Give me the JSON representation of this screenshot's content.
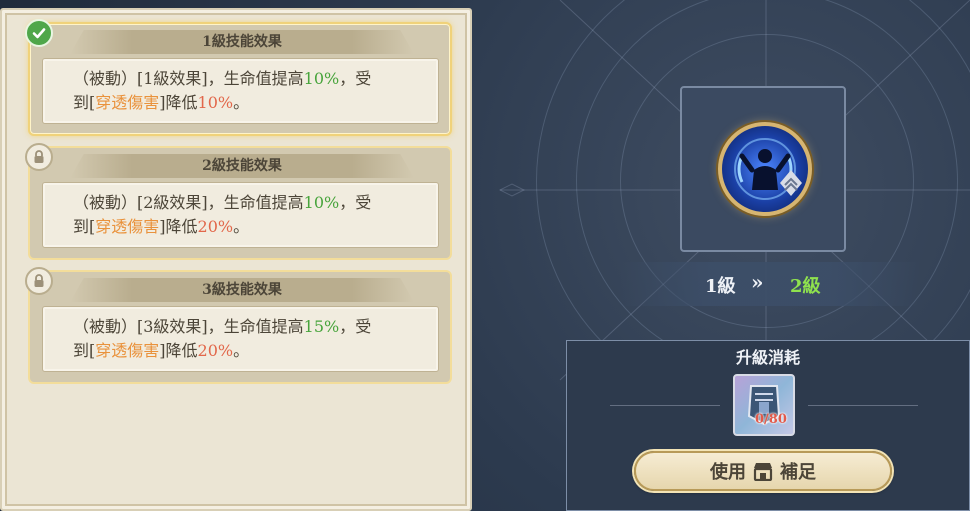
{
  "cards": [
    {
      "title": "1級技能效果",
      "line1_pre": "（被動）[1級效果]，生命值提高",
      "line1_val": "10%",
      "line1_post": "，受",
      "line2_pre": "到[",
      "line2_kw": "穿透傷害",
      "line2_mid": "]降低",
      "line2_val": "10%",
      "line2_post": "。",
      "status": "unlocked",
      "icon": "check-icon"
    },
    {
      "title": "2級技能效果",
      "line1_pre": "（被動）[2級效果]，生命值提高",
      "line1_val": "10%",
      "line1_post": "，受",
      "line2_pre": "到[",
      "line2_kw": "穿透傷害",
      "line2_mid": "]降低",
      "line2_val": "20%",
      "line2_post": "。",
      "status": "locked",
      "icon": "lock-icon"
    },
    {
      "title": "3級技能效果",
      "line1_pre": "（被動）[3級效果]，生命值提高",
      "line1_val": "15%",
      "line1_post": "，受",
      "line2_pre": "到[",
      "line2_kw": "穿透傷害",
      "line2_mid": "]降低",
      "line2_val": "20%",
      "line2_post": "。",
      "status": "locked",
      "icon": "lock-icon"
    }
  ],
  "skill": {
    "icon": "passive-skill-icon",
    "from_level": "1級",
    "arrow": "»",
    "to_level": "2級"
  },
  "upgrade": {
    "title": "升級消耗",
    "item_icon": "skill-book-icon",
    "item_count": "0/80",
    "button_pre": "使用",
    "button_icon": "shop-icon",
    "button_post": "補足"
  },
  "colors": {
    "highlight_value": "#48a43c",
    "keyword": "#e9923c",
    "reduce_value": "#e2674a",
    "next_level": "#8fe24e",
    "insufficient": "#e25a4a"
  }
}
